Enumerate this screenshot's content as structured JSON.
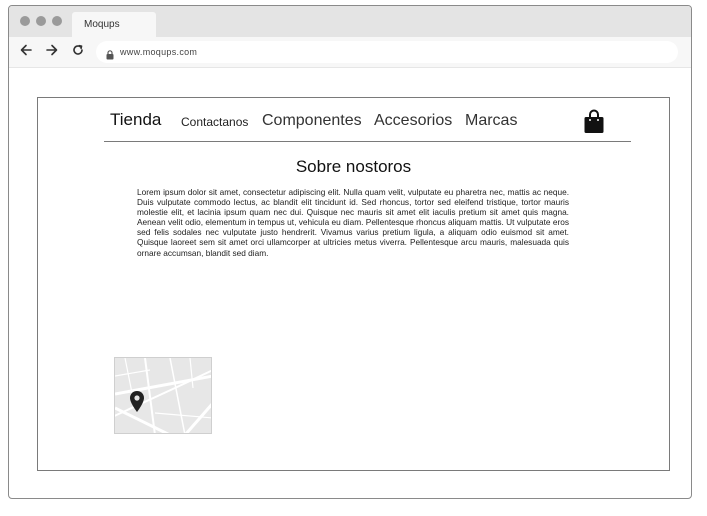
{
  "browser": {
    "tab_title": "Moqups",
    "url": "www.moqups.com",
    "back_icon": "arrow-left-icon",
    "forward_icon": "arrow-right-icon",
    "reload_icon": "reload-icon"
  },
  "site": {
    "brand": "Tienda",
    "nav": [
      "Contactanos",
      "Componentes",
      "Accesorios",
      "Marcas"
    ],
    "cart_icon": "shopping-bag-icon"
  },
  "content": {
    "heading": "Sobre nostoros",
    "paragraph": "Lorem ipsum dolor sit amet, consectetur adipiscing elit. Nulla quam velit, vulputate eu pharetra nec, mattis ac neque. Duis vulputate commodo lectus, ac blandit elit tincidunt id. Sed rhoncus, tortor sed eleifend tristique, tortor mauris molestie elit, et lacinia ipsum quam nec dui. Quisque nec mauris sit amet elit iaculis pretium sit amet quis magna. Aenean velit odio, elementum in tempus ut, vehicula eu diam. Pellentesque rhoncus aliquam mattis. Ut vulputate eros sed felis sodales nec vulputate justo hendrerit. Vivamus varius pretium ligula, a aliquam odio euismod sit amet. Quisque laoreet sem sit amet orci ullamcorper at ultricies metus viverra. Pellentesque arcu mauris, malesuada quis ornare accumsan, blandit sed diam."
  },
  "map": {
    "icon": "map-pin-icon"
  }
}
